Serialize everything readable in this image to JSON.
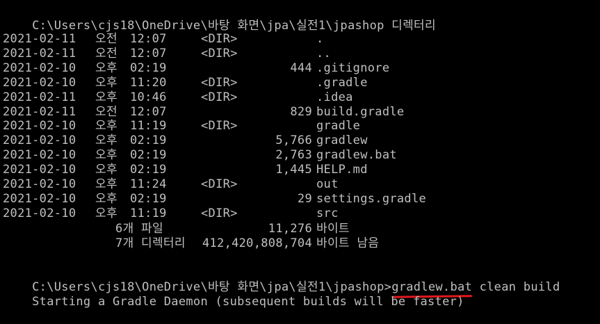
{
  "header": {
    "directory_line": "C:\\Users\\cjs18\\OneDrive\\바탕 화면\\jpa\\실전1\\jpashop 디렉터리"
  },
  "listing": [
    {
      "date": "2021-02-11",
      "ampm": "오전",
      "time": "12:07",
      "dir": "<DIR>",
      "size": "",
      "name": "."
    },
    {
      "date": "2021-02-11",
      "ampm": "오전",
      "time": "12:07",
      "dir": "<DIR>",
      "size": "",
      "name": ".."
    },
    {
      "date": "2021-02-10",
      "ampm": "오후",
      "time": "02:19",
      "dir": "",
      "size": "444",
      "name": ".gitignore"
    },
    {
      "date": "2021-02-10",
      "ampm": "오후",
      "time": "11:20",
      "dir": "<DIR>",
      "size": "",
      "name": ".gradle"
    },
    {
      "date": "2021-02-11",
      "ampm": "오후",
      "time": "10:46",
      "dir": "<DIR>",
      "size": "",
      "name": ".idea"
    },
    {
      "date": "2021-02-11",
      "ampm": "오전",
      "time": "12:07",
      "dir": "",
      "size": "829",
      "name": "build.gradle"
    },
    {
      "date": "2021-02-10",
      "ampm": "오후",
      "time": "11:19",
      "dir": "<DIR>",
      "size": "",
      "name": "gradle"
    },
    {
      "date": "2021-02-10",
      "ampm": "오후",
      "time": "02:19",
      "dir": "",
      "size": "5,766",
      "name": "gradlew"
    },
    {
      "date": "2021-02-10",
      "ampm": "오후",
      "time": "02:19",
      "dir": "",
      "size": "2,763",
      "name": "gradlew.bat"
    },
    {
      "date": "2021-02-10",
      "ampm": "오후",
      "time": "02:19",
      "dir": "",
      "size": "1,445",
      "name": "HELP.md"
    },
    {
      "date": "2021-02-10",
      "ampm": "오후",
      "time": "11:24",
      "dir": "<DIR>",
      "size": "",
      "name": "out"
    },
    {
      "date": "2021-02-10",
      "ampm": "오후",
      "time": "02:19",
      "dir": "",
      "size": "29",
      "name": "settings.gradle"
    },
    {
      "date": "2021-02-10",
      "ampm": "오후",
      "time": "11:19",
      "dir": "<DIR>",
      "size": "",
      "name": "src"
    }
  ],
  "summary": {
    "files_count": "6개 파일",
    "files_size": "11,276",
    "files_unit": "바이트",
    "dirs_count": "7개 디렉터리",
    "free_size": "412,420,808,704",
    "free_unit": "바이트 남음"
  },
  "prompt": {
    "path": "C:\\Users\\cjs18\\OneDrive\\바탕 화면\\jpa\\실전1\\jpashop>",
    "command_highlighted": "gradlew.bat",
    "command_rest": " clean build"
  },
  "output": {
    "daemon_line": "Starting a Gradle Daemon (subsequent builds will be faster)"
  },
  "colors": {
    "background": "#000000",
    "text": "#c0c0c0",
    "annotation": "#e0191d"
  }
}
